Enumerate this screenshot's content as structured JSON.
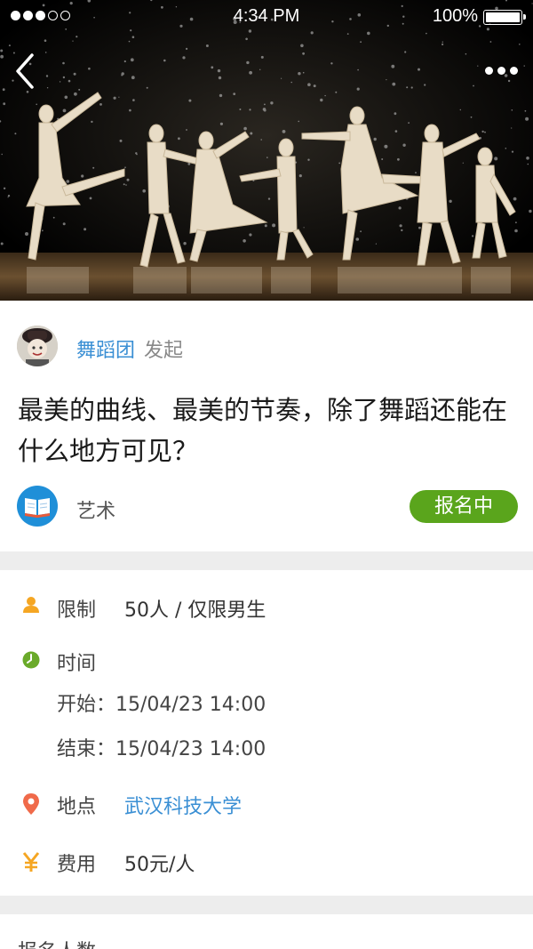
{
  "status_bar": {
    "time": "4:34 PM",
    "battery": "100%",
    "signal_filled": 3,
    "signal_total": 5
  },
  "header": {
    "back_icon": "chevron-left-icon",
    "more_icon": "more-dots-icon"
  },
  "organizer": {
    "name": "舞蹈团",
    "action": "发起"
  },
  "event": {
    "title": "最美的曲线、最美的节奏，除了舞蹈还能在什么地方可见？",
    "category": "艺术",
    "status": "报名中"
  },
  "details": {
    "limit": {
      "label": "限制",
      "value": "50人 / 仅限男生",
      "icon": "person-icon"
    },
    "time": {
      "label": "时间",
      "icon": "clock-icon",
      "start": "开始：15/04/23 14:00",
      "end": "结束：15/04/23 14:00"
    },
    "location": {
      "label": "地点",
      "value": "武汉科技大学",
      "icon": "location-pin-icon"
    },
    "fee": {
      "label": "费用",
      "value": "50元/人",
      "icon": "yuan-icon"
    }
  },
  "participants": {
    "label": "报名人数"
  },
  "colors": {
    "accent_blue": "#3a8fd4",
    "status_green": "#5aa51c",
    "icon_orange": "#f5a623",
    "icon_green": "#6aaa2a",
    "pin_red": "#f06a4a"
  }
}
